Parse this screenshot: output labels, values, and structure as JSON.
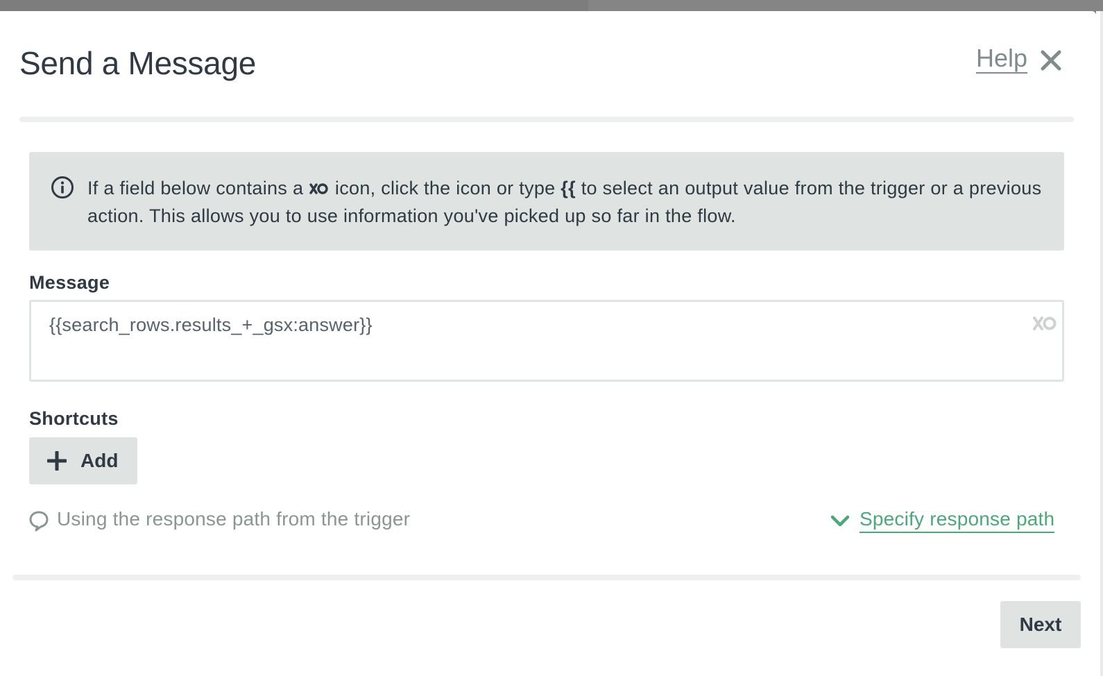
{
  "background": {
    "fragment_text": "..."
  },
  "dialog": {
    "title": "Send a Message",
    "help_label": "Help",
    "close_icon": "close-icon"
  },
  "info": {
    "icon": "info-circle-icon",
    "text_part1": "If a field below contains a",
    "text_part2": "icon, click the icon or type",
    "text_braces": "{{",
    "text_part3": "to select an output value from the trigger or a previous action. This allows you to use information you've picked up so far in the flow."
  },
  "message": {
    "label": "Message",
    "value": "{{search_rows.results_+_gsx:answer}}",
    "token_icon": "infinity-variable-icon"
  },
  "shortcuts": {
    "label": "Shortcuts",
    "add_label": "Add"
  },
  "response_path": {
    "info_text": "Using the response path from the trigger",
    "specify_label": "Specify response path"
  },
  "footer": {
    "next_label": "Next"
  },
  "colors": {
    "primary_text": "#2f3a44",
    "muted_text": "#8a9693",
    "link_green": "#4aa879",
    "panel_gray": "#dfe3e1",
    "backdrop": "#7d7d7d"
  }
}
